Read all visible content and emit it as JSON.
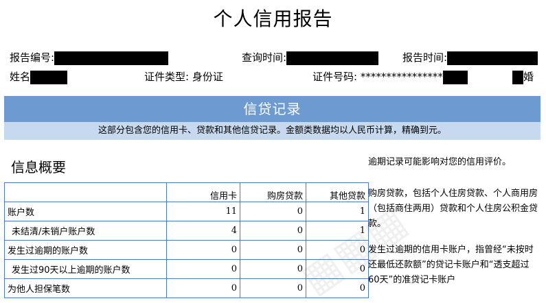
{
  "report": {
    "title": "个人信用报告",
    "report_no_label": "报告编号:",
    "query_time_label": "查询时间:",
    "report_time_label": "报告时间:",
    "name_label": "姓名",
    "id_type_label": "证件类型:",
    "id_type_value": "身份证",
    "id_no_label": "证件号码:",
    "id_no_masked": "****************",
    "marital_suffix": "婚"
  },
  "banner": {
    "title": "信贷记录",
    "subtitle": "这部分包含您的信用卡、贷款和其他信贷记录。金额类数据均以人民币计算，精确到元。"
  },
  "summary": {
    "section_title": "信息概要",
    "headers": [
      "",
      "信用卡",
      "购房贷款",
      "其他贷款"
    ],
    "rows": [
      {
        "label": "账户数",
        "values": [
          "11",
          "0",
          "1"
        ]
      },
      {
        "label": "未结清/未销户账户数",
        "values": [
          "4",
          "0",
          "1"
        ]
      },
      {
        "label": "发生过逾期的账户数",
        "values": [
          "0",
          "0",
          "0"
        ]
      },
      {
        "label": "发生过90天以上逾期的账户数",
        "values": [
          "0",
          "0",
          "0"
        ]
      },
      {
        "label": "为他人担保笔数",
        "values": [
          "0",
          "0",
          "0"
        ]
      }
    ]
  },
  "notes": {
    "n1": "逾期记录可能影响对您的信用评价。",
    "n2": "购房贷款，包括个人住房贷款、个人商用房（包括商住两用）贷款和个人住房公积金贷款。",
    "n3": "发生过逾期的信用卡账户，指曾经“未按时还最低还款额”的贷记卡账户和“透支超过60天”的准贷记卡账户"
  },
  "colors": {
    "banner": "#6d9bd1",
    "subbanner": "#c7d9ee",
    "table_border": "#4a7bbf"
  }
}
